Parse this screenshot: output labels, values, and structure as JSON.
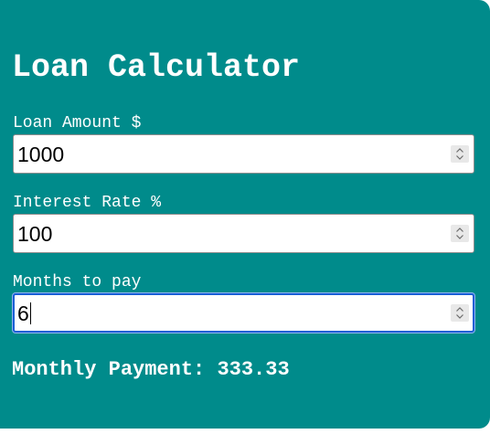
{
  "title": "Loan Calculator",
  "fields": [
    {
      "label": "Loan Amount $",
      "value": "1000"
    },
    {
      "label": "Interest Rate %",
      "value": "100"
    },
    {
      "label": "Months to pay",
      "value": "6"
    }
  ],
  "result": {
    "label": "Monthly Payment:",
    "value": "333.33"
  },
  "colors": {
    "background": "#008b8b",
    "text": "#ffffff",
    "focus": "#1a5fd6"
  },
  "icons": {
    "spinner": "spinner-arrows-icon"
  }
}
